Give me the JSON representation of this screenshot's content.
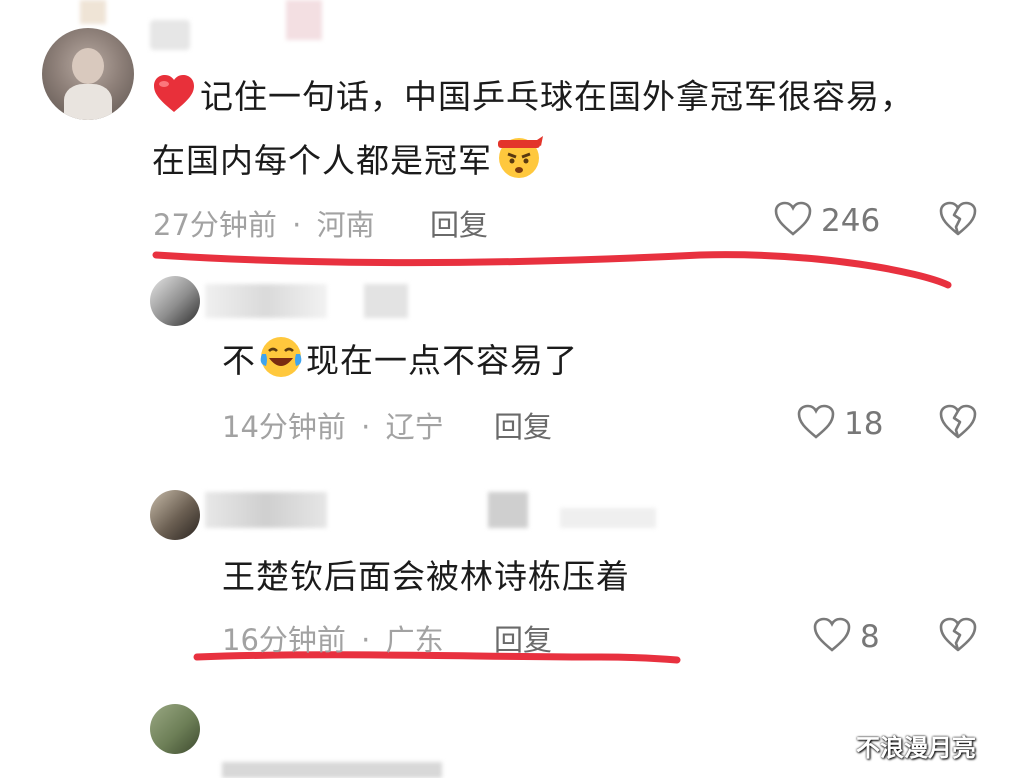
{
  "comments": [
    {
      "text_line1": "记住一句话，中国乒乓球在国外拿冠军很容易，",
      "text_line2": "在国内每个人都是冠军",
      "time": "27分钟前",
      "sep": "·",
      "location": "河南",
      "reply": "回复",
      "likes": "246"
    },
    {
      "text_pre": "不",
      "text_post": "现在一点不容易了",
      "time": "14分钟前",
      "sep": "·",
      "location": "辽宁",
      "reply": "回复",
      "likes": "18"
    },
    {
      "text": "王楚钦后面会被林诗栋压着",
      "time": "16分钟前",
      "sep": "·",
      "location": "广东",
      "reply": "回复",
      "likes": "8"
    }
  ],
  "watermark": "不浪漫月亮",
  "colors": {
    "annotation_red": "#e8313f",
    "meta_gray": "#a2a2a2",
    "heart_red": "#e8303a"
  }
}
